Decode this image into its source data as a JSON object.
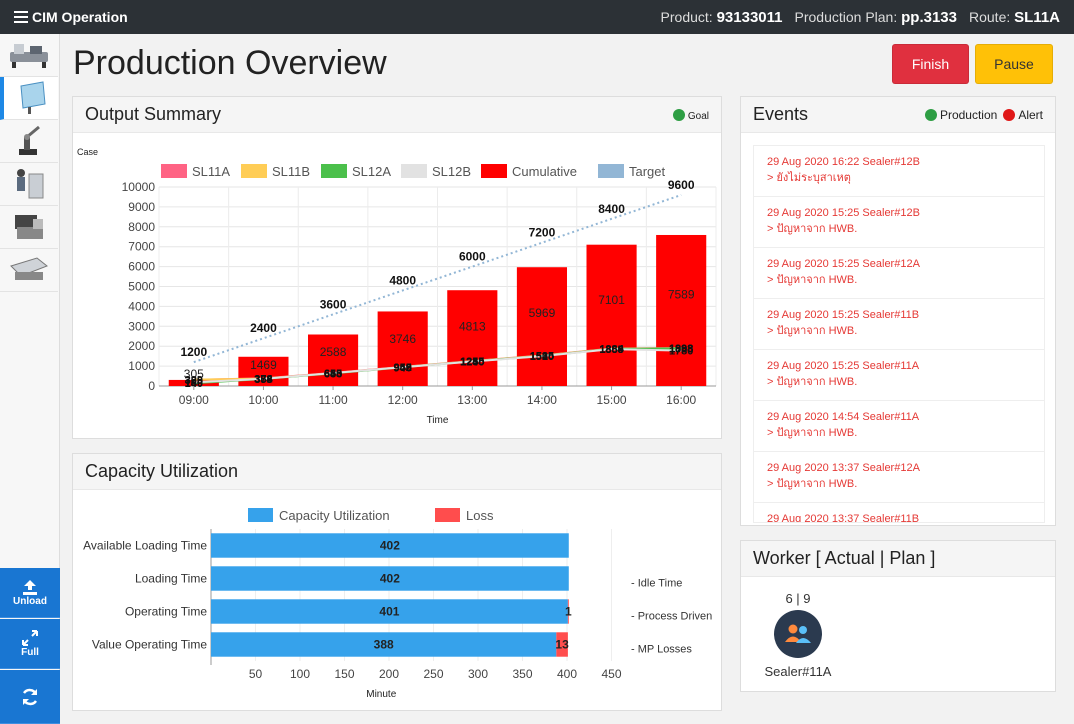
{
  "topbar": {
    "menu_icon": "hamburger-icon",
    "title": "CIM Operation",
    "product_label": "Product:",
    "product_value": "93133011",
    "plan_label": "Production Plan:",
    "plan_value": "pp.3133",
    "route_label": "Route:",
    "route_value": "SL11A"
  },
  "sidebar": {
    "buttons": [
      {
        "label": "Unload",
        "icon": "upload-icon"
      },
      {
        "label": "Full",
        "icon": "expand-icon"
      },
      {
        "label": "",
        "icon": "refresh-icon"
      }
    ]
  },
  "page": {
    "title": "Production Overview",
    "finish_label": "Finish",
    "pause_label": "Pause"
  },
  "colors": {
    "finish": "#e0303f",
    "pause": "#ffc107",
    "goal": "#2e9e44",
    "production": "#2e9e44",
    "alert": "#e01818",
    "bar_red": "#ff0000",
    "target": "#92b6d5",
    "capacity": "#36a2eb",
    "loss": "#ff4d4d"
  },
  "output_summary": {
    "title": "Output Summary",
    "goal_label": "Goal"
  },
  "capacity": {
    "title": "Capacity Utilization"
  },
  "events": {
    "title": "Events",
    "legend_production": "Production",
    "legend_alert": "Alert",
    "items": [
      {
        "time": "29 Aug 2020 16:22 Sealer#12B",
        "detail": "> ยังไม่ระบุสาเหตุ"
      },
      {
        "time": "29 Aug 2020 15:25 Sealer#12B",
        "detail": "> ปัญหาจาก HWB."
      },
      {
        "time": "29 Aug 2020 15:25 Sealer#12A",
        "detail": "> ปัญหาจาก HWB."
      },
      {
        "time": "29 Aug 2020 15:25 Sealer#11B",
        "detail": "> ปัญหาจาก HWB."
      },
      {
        "time": "29 Aug 2020 15:25 Sealer#11A",
        "detail": "> ปัญหาจาก HWB."
      },
      {
        "time": "29 Aug 2020 14:54 Sealer#11A",
        "detail": "> ปัญหาจาก HWB."
      },
      {
        "time": "29 Aug 2020 13:37 Sealer#12A",
        "detail": "> ปัญหาจาก HWB."
      },
      {
        "time": "29 Aug 2020 13:37 Sealer#11B",
        "detail": ""
      }
    ]
  },
  "worker": {
    "title": "Worker [ Actual | Plan ]",
    "ratio": "6 | 9",
    "name": "Sealer#11A",
    "icon": "users-icon"
  },
  "chart_data": [
    {
      "type": "bar",
      "ylabel": "Case",
      "xlabel": "Time",
      "categories": [
        "09:00",
        "10:00",
        "11:00",
        "12:00",
        "13:00",
        "14:00",
        "15:00",
        "16:00"
      ],
      "ylim": [
        0,
        10000
      ],
      "yticks": [
        0,
        1000,
        2000,
        3000,
        4000,
        5000,
        6000,
        7000,
        8000,
        9000,
        10000
      ],
      "grid": true,
      "legend_position": "top",
      "series": [
        {
          "name": "SL11A",
          "kind": "line",
          "color": "#ff6384",
          "values": [
            305,
            384,
            660,
            959,
            1255,
            1535,
            1884,
            1908
          ]
        },
        {
          "name": "SL11B",
          "kind": "line",
          "color": "#ffcd56",
          "values": [
            320,
            372,
            645,
            952,
            1245,
            1525,
            1869,
            1898
          ]
        },
        {
          "name": "SL12A",
          "kind": "line",
          "color": "#4bc04b",
          "values": [
            140,
            355,
            633,
            940,
            1240,
            1510,
            1863,
            1888
          ]
        },
        {
          "name": "SL12B",
          "kind": "line",
          "color": "#e2e2e2",
          "values": [
            180,
            358,
            650,
            945,
            1230,
            1500,
            1855,
            1780
          ]
        },
        {
          "name": "Cumulative",
          "kind": "bar",
          "color": "#ff0000",
          "values": [
            305,
            1469,
            2588,
            3746,
            4813,
            5969,
            7101,
            7589
          ]
        },
        {
          "name": "Target",
          "kind": "dotted-line",
          "color": "#92b6d5",
          "values": [
            1200,
            2400,
            3600,
            4800,
            6000,
            7200,
            8400,
            9600
          ]
        }
      ],
      "target_labels": [
        "1200",
        "2400",
        "3600",
        "4800",
        "6000",
        "7200",
        "8400",
        "9600"
      ],
      "cumulative_labels": [
        "305",
        "1469",
        "2588",
        "3746",
        "4813",
        "5969",
        "7101",
        "7589"
      ],
      "line_labels": [
        [
          "305",
          "320",
          "140",
          "180"
        ],
        [
          "384",
          "372",
          "355",
          "358"
        ],
        [
          "660",
          "645",
          "633",
          "650"
        ],
        [
          "959",
          "952",
          "940",
          "945"
        ],
        [
          "1255",
          "1245",
          "1240",
          "1230"
        ],
        [
          "1535",
          "1525",
          "1510",
          "1500"
        ],
        [
          "1884",
          "1869",
          "1863",
          "1855"
        ],
        [
          "1908",
          "1898",
          "1888",
          "1780"
        ]
      ]
    },
    {
      "type": "bar",
      "orientation": "horizontal",
      "stacked": true,
      "xlabel": "Minute",
      "categories": [
        "Available Loading Time",
        "Loading Time",
        "Operating Time",
        "Value Operating Time"
      ],
      "xlim": [
        0,
        450
      ],
      "xticks": [
        50,
        100,
        150,
        200,
        250,
        300,
        350,
        400,
        450
      ],
      "legend_position": "top",
      "series": [
        {
          "name": "Capacity Utilization",
          "color": "#36a2eb",
          "values": [
            402,
            402,
            401,
            388
          ]
        },
        {
          "name": "Loss",
          "color": "#ff4d4d",
          "values": [
            0,
            0,
            1,
            13
          ]
        }
      ],
      "value_labels": [
        [
          "402",
          ""
        ],
        [
          "402",
          ""
        ],
        [
          "401",
          "1"
        ],
        [
          "388",
          "13"
        ]
      ],
      "annotations": [
        "",
        "- Idle Time",
        "- Process Driven",
        "- MP Losses"
      ]
    }
  ]
}
